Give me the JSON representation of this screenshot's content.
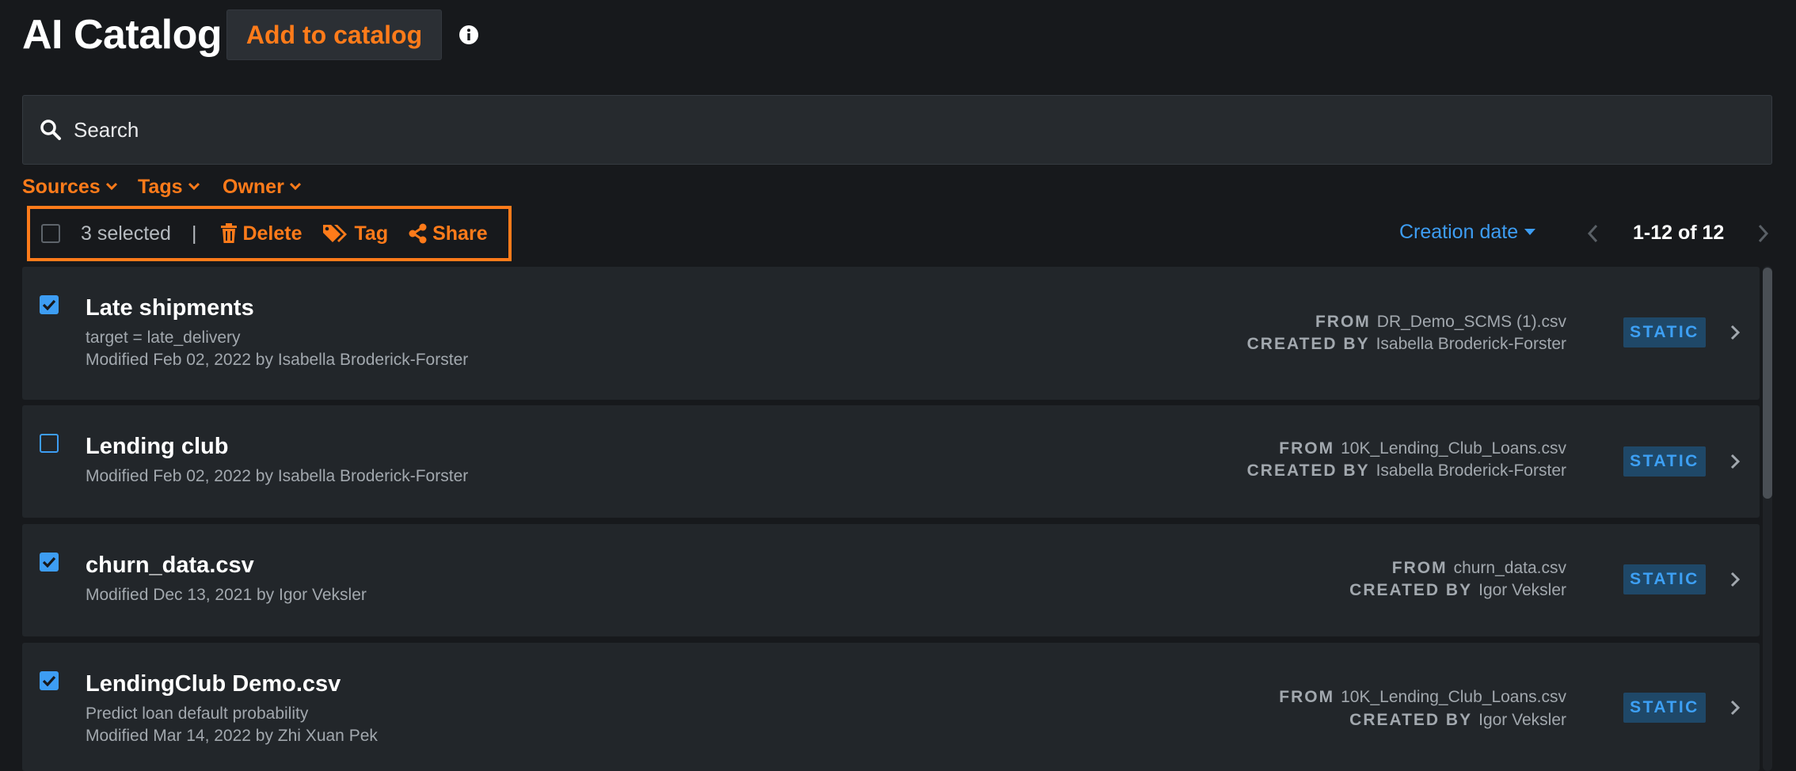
{
  "header": {
    "title": "AI Catalog",
    "add_button_label": "Add to catalog",
    "info_icon": "info-circle-icon"
  },
  "search": {
    "placeholder": "Search",
    "value": ""
  },
  "filters": [
    {
      "label": "Sources"
    },
    {
      "label": "Tags"
    },
    {
      "label": "Owner"
    }
  ],
  "bulk_actions": {
    "selected_text": "3 selected",
    "separator": "|",
    "delete_label": "Delete",
    "tag_label": "Tag",
    "share_label": "Share"
  },
  "sort": {
    "label": "Creation date"
  },
  "pagination": {
    "range": "1-12 of 12"
  },
  "items": [
    {
      "checked": true,
      "title": "Late shipments",
      "description": "target = late_delivery",
      "modified": "Modified Feb 02, 2022 by Isabella Broderick-Forster",
      "from_label": "FROM",
      "from_value": "DR_Demo_SCMS (1).csv",
      "created_label": "CREATED BY",
      "created_value": "Isabella Broderick-Forster",
      "badge": "STATIC"
    },
    {
      "checked": false,
      "title": "Lending club",
      "description": "",
      "modified": "Modified Feb 02, 2022 by Isabella Broderick-Forster",
      "from_label": "FROM",
      "from_value": "10K_Lending_Club_Loans.csv",
      "created_label": "CREATED BY",
      "created_value": "Isabella Broderick-Forster",
      "badge": "STATIC"
    },
    {
      "checked": true,
      "title": "churn_data.csv",
      "description": "",
      "modified": "Modified Dec 13, 2021 by Igor Veksler",
      "from_label": "FROM",
      "from_value": "churn_data.csv",
      "created_label": "CREATED BY",
      "created_value": "Igor Veksler",
      "badge": "STATIC"
    },
    {
      "checked": true,
      "title": "LendingClub Demo.csv",
      "description": "Predict loan default probability",
      "modified": "Modified Mar 14, 2022 by Zhi Xuan Pek",
      "from_label": "FROM",
      "from_value": "10K_Lending_Club_Loans.csv",
      "created_label": "CREATED BY",
      "created_value": "Igor Veksler",
      "badge": "STATIC"
    }
  ],
  "colors": {
    "accent_orange": "#ff7b1a",
    "accent_blue": "#3d9df3",
    "background": "#17191c",
    "row_background": "#22262a",
    "badge_background": "#1f4868"
  }
}
